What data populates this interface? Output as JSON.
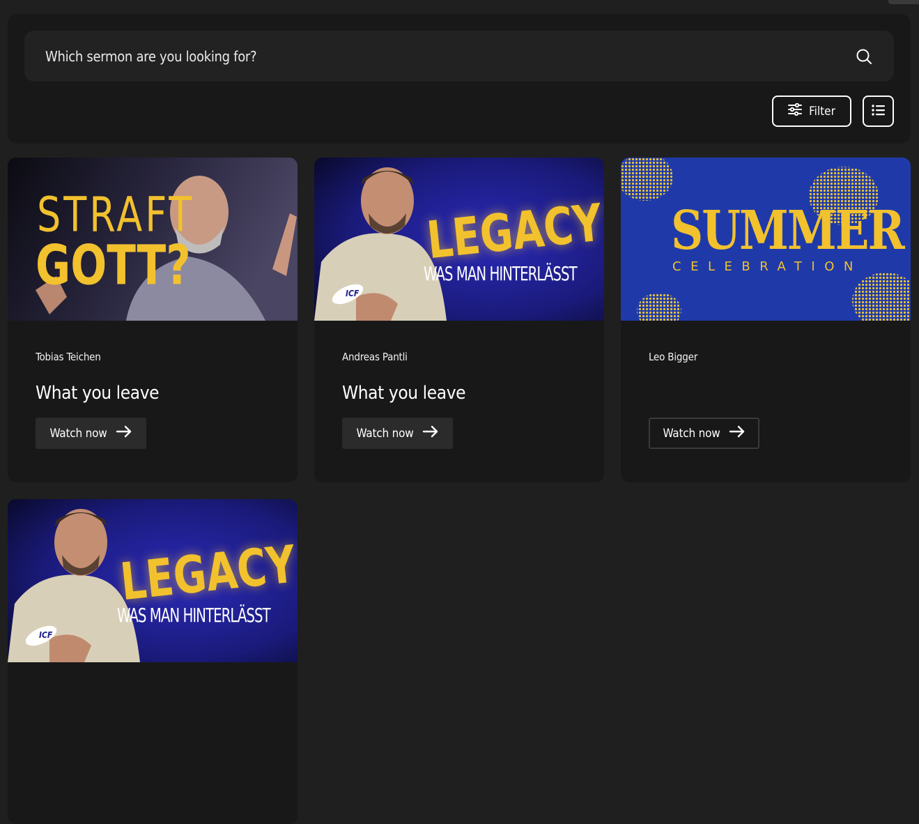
{
  "search": {
    "placeholder": "Which sermon are you looking for?"
  },
  "toolbar": {
    "filter_label": "Filter"
  },
  "colors": {
    "background": "#1f1f1f",
    "panel": "#181818",
    "accent_yellow": "#f2c12e",
    "legacy_blue": "#1c1d8a",
    "summer_blue": "#1f3aa8"
  },
  "cards": [
    {
      "speaker": "Tobias Teichen",
      "title": "What you leave",
      "cta": "Watch now",
      "art": {
        "line1": "STRAFT",
        "line2": "GOTT?"
      }
    },
    {
      "speaker": "Andreas Pantli",
      "title": "What you leave",
      "cta": "Watch now",
      "art": {
        "line1": "LEGACY",
        "line2": "WAS MAN HINTERLÄSST",
        "logo": "ICF"
      }
    },
    {
      "speaker": "Leo Bigger",
      "title": "",
      "cta": "Watch now",
      "art": {
        "line1": "SUMMER",
        "line2": "CELEBRATION"
      }
    },
    {
      "speaker": "",
      "title": "",
      "cta": "",
      "art": {
        "line1": "LEGACY",
        "line2": "WAS MAN HINTERLÄSST",
        "logo": "ICF"
      }
    }
  ]
}
